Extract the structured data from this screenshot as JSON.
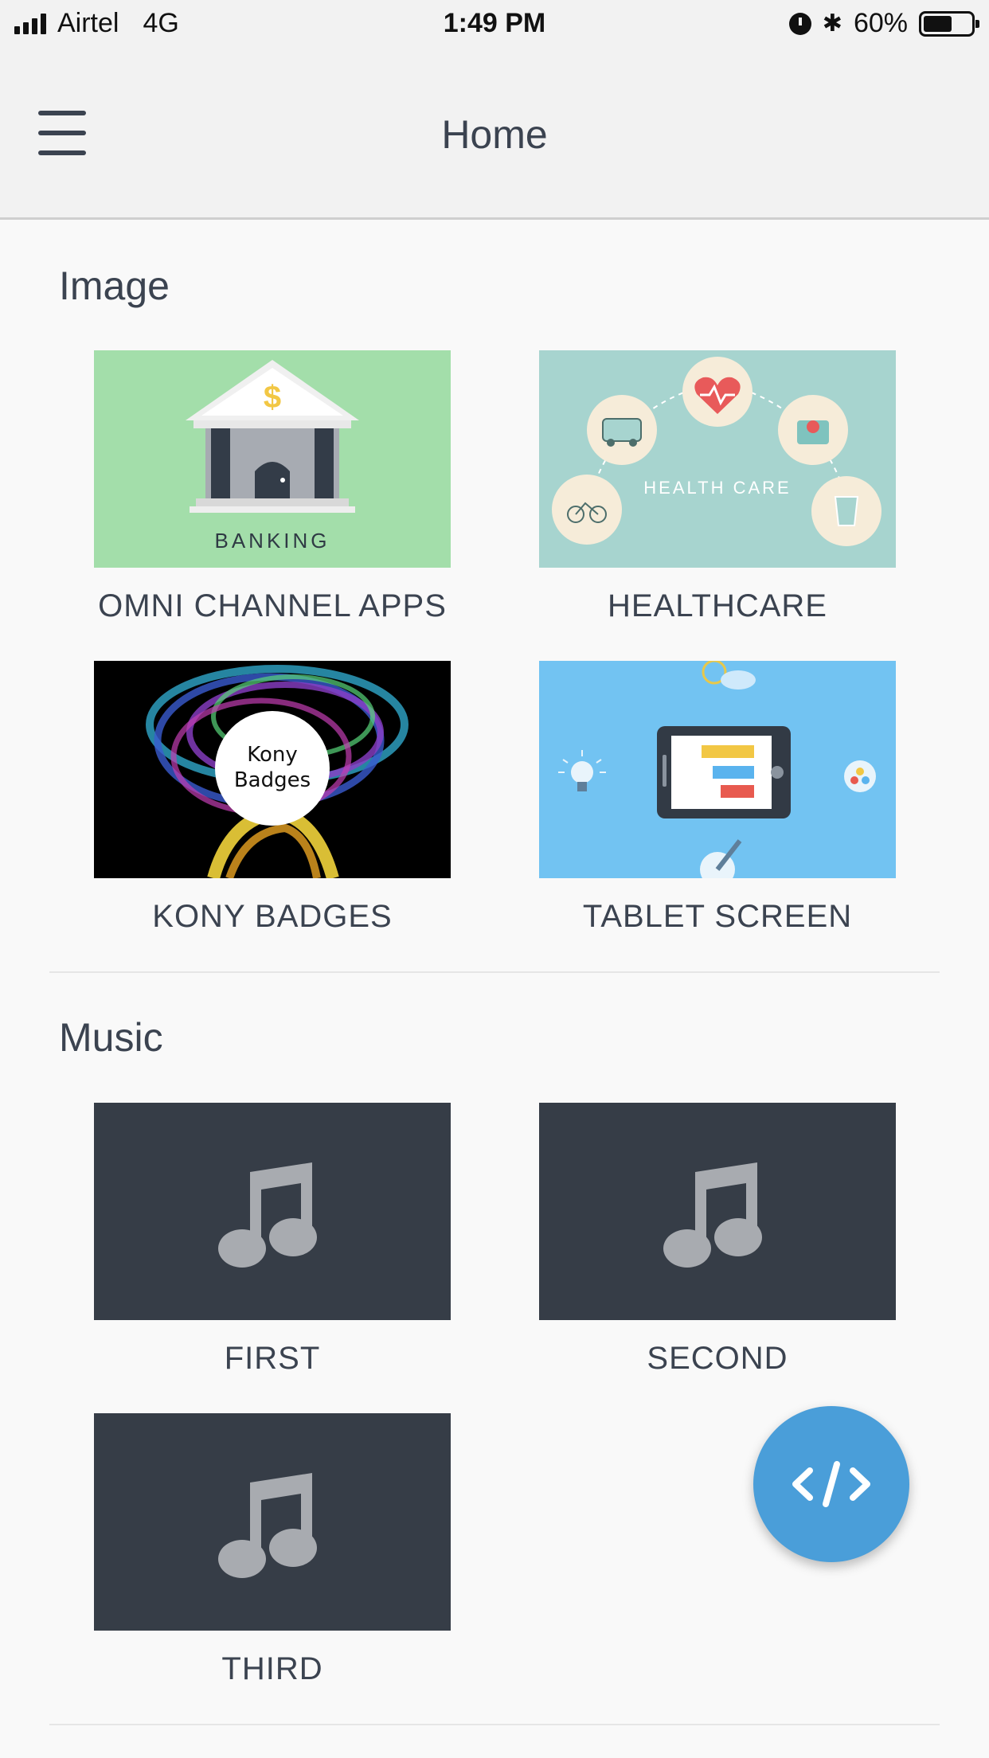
{
  "status_bar": {
    "carrier": "Airtel",
    "network": "4G",
    "time": "1:49 PM",
    "battery_text": "60%",
    "battery_level": 0.6
  },
  "header": {
    "title": "Home",
    "menu_icon": "hamburger-menu-icon"
  },
  "sections": {
    "image": {
      "title": "Image",
      "tiles": [
        {
          "label": "OMNI CHANNEL APPS",
          "image_caption": "BANKING"
        },
        {
          "label": "HEALTHCARE",
          "image_caption": "HEALTH CARE"
        },
        {
          "label": "KONY BADGES",
          "image_caption_line1": "Kony",
          "image_caption_line2": "Badges"
        },
        {
          "label": "TABLET SCREEN"
        }
      ]
    },
    "music": {
      "title": "Music",
      "tiles": [
        {
          "label": "FIRST",
          "icon": "music-note-icon"
        },
        {
          "label": "SECOND",
          "icon": "music-note-icon"
        },
        {
          "label": "THIRD",
          "icon": "music-note-icon"
        }
      ]
    }
  },
  "fab": {
    "icon": "code-icon",
    "color": "#4a9ed9"
  },
  "colors": {
    "header_bg": "#f2f2f2",
    "music_tile_bg": "#363d47",
    "banking_bg": "#a3deaa",
    "health_bg": "#a7d4cf",
    "tablet_bg": "#72c3f2"
  }
}
